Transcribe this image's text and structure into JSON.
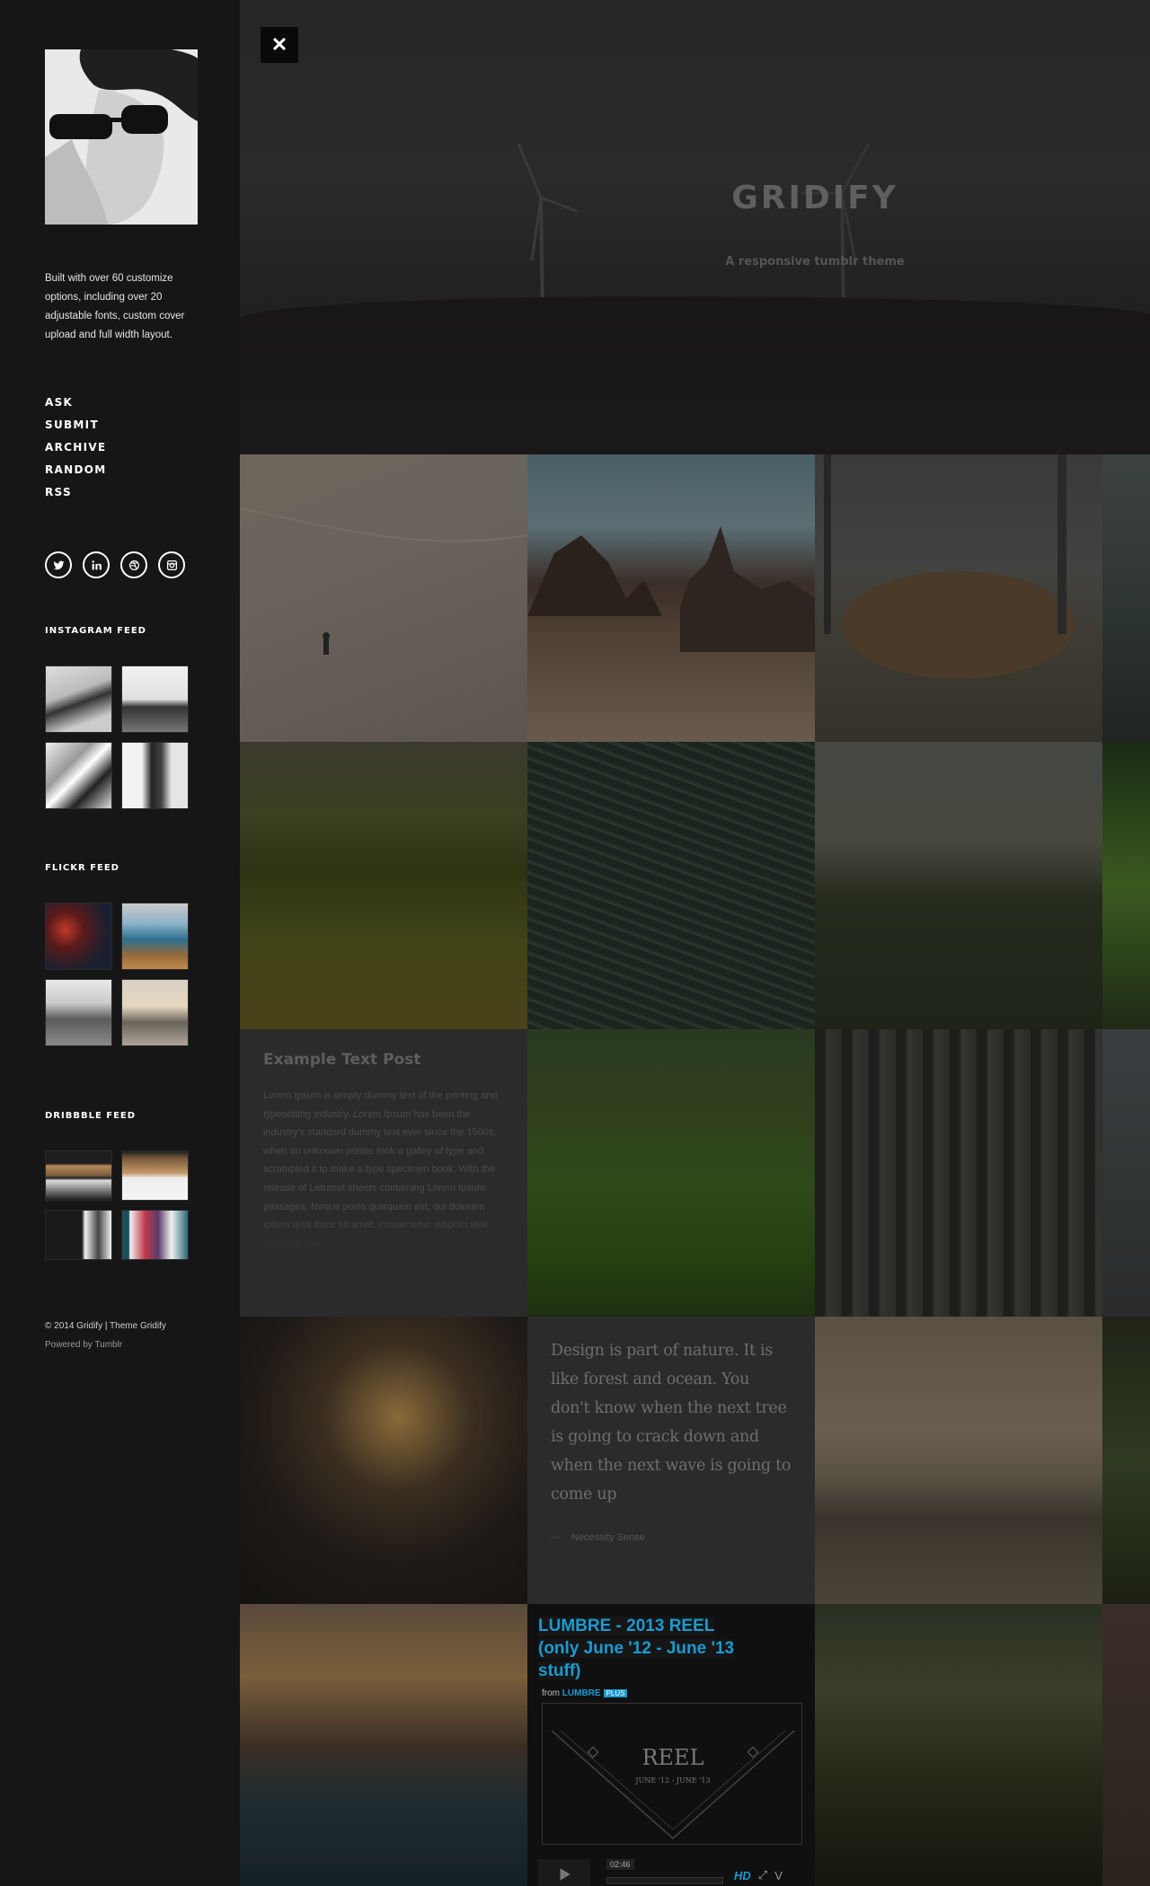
{
  "sidebar": {
    "bio": "Built with over 60 customize options, including over 20 adjustable fonts, custom cover upload and full width layout.",
    "nav": [
      "ASK",
      "SUBMIT",
      "ARCHIVE",
      "RANDOM",
      "RSS"
    ],
    "social_icons": [
      "twitter-icon",
      "linkedin-icon",
      "dribbble-icon",
      "instagram-icon"
    ],
    "instagram_title": "INSTAGRAM FEED",
    "flickr_title": "FLICKR FEED",
    "dribbble_title": "DRIBBBLE FEED",
    "copyright": "© 2014 Gridify | Theme Gridify",
    "powered": "Powered by Tumblr"
  },
  "header": {
    "close_label": "✕",
    "title": "GRIDIFY",
    "subtitle": "A responsive tumblr theme"
  },
  "posts": {
    "text_title": "Example Text Post",
    "text_body": "Lorem Ipsum is simply dummy text of the printing and typesetting industry. Lorem Ipsum has been the industry's standard dummy text ever since the 1500s, when an unknown printer took a galley of type and scrambled it to make a type specimen book. With the release of Letraset sheets containing Lorem Ipsum passages. Neque porro quisquam est, qui dolorem ipsum quia dolor sit amet, consectetur, adipisci velit, sed quia non",
    "quote_text": "Design is part of nature. It is like forest and ocean. You don't know when the next tree is going to crack down and when the next wave is going to come up",
    "quote_source": "Necessity Sense",
    "quote_dash": "—",
    "video_title": "LUMBRE - 2013 REEL (only June '12 - June '13 stuff)",
    "video_from": "from",
    "video_author": "LUMBRE",
    "video_plus": "PLUS",
    "video_reel": "REEL",
    "video_dates": "JUNE '12 - JUNE '13",
    "video_time": "02:46",
    "video_hd": "HD"
  },
  "colors": {
    "accent": "#1b9bd1",
    "sidebar_bg": "#161616"
  }
}
